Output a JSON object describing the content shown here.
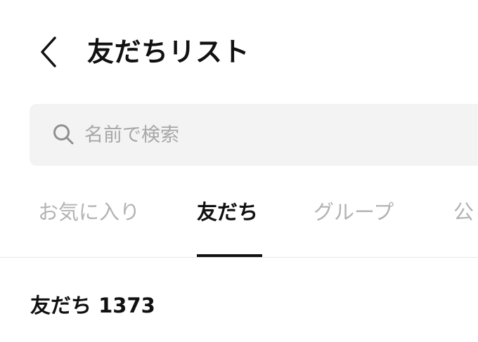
{
  "header": {
    "back_icon": "chevron-left-icon",
    "title": "友だちリスト"
  },
  "search": {
    "icon": "search-icon",
    "placeholder": "名前で検索",
    "value": ""
  },
  "tabs": [
    {
      "label": "お気に入り",
      "active": false
    },
    {
      "label": "友だち",
      "active": true
    },
    {
      "label": "グループ",
      "active": false
    },
    {
      "label": "公",
      "active": false
    }
  ],
  "section": {
    "label": "友だち",
    "count": "1373"
  },
  "colors": {
    "text": "#111111",
    "inactive_tab": "#b3b3b3",
    "search_bg": "#f3f3f3",
    "placeholder": "#a7a7a7",
    "divider": "#e8e8e8"
  }
}
